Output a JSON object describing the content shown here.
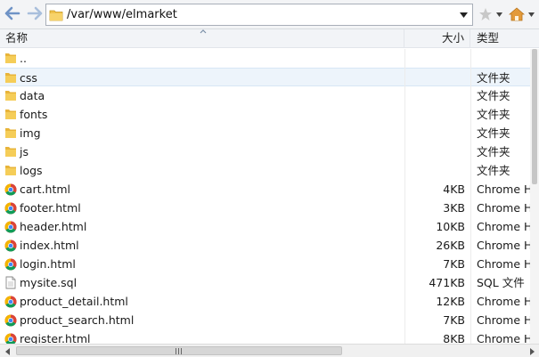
{
  "toolbar": {
    "path": "/var/www/elmarket",
    "back_icon": "back-arrow-icon",
    "forward_icon": "forward-arrow-icon"
  },
  "columns": {
    "name": "名称",
    "size": "大小",
    "type": "类型"
  },
  "files": [
    {
      "name": "..",
      "size": "",
      "type": "",
      "icon": "folder"
    },
    {
      "name": "css",
      "size": "",
      "type": "文件夹",
      "icon": "folder",
      "selected": true
    },
    {
      "name": "data",
      "size": "",
      "type": "文件夹",
      "icon": "folder"
    },
    {
      "name": "fonts",
      "size": "",
      "type": "文件夹",
      "icon": "folder"
    },
    {
      "name": "img",
      "size": "",
      "type": "文件夹",
      "icon": "folder"
    },
    {
      "name": "js",
      "size": "",
      "type": "文件夹",
      "icon": "folder"
    },
    {
      "name": "logs",
      "size": "",
      "type": "文件夹",
      "icon": "folder"
    },
    {
      "name": "cart.html",
      "size": "4KB",
      "type": "Chrome HTML",
      "icon": "chrome"
    },
    {
      "name": "footer.html",
      "size": "3KB",
      "type": "Chrome HTML",
      "icon": "chrome"
    },
    {
      "name": "header.html",
      "size": "10KB",
      "type": "Chrome HTML",
      "icon": "chrome"
    },
    {
      "name": "index.html",
      "size": "26KB",
      "type": "Chrome HTML",
      "icon": "chrome"
    },
    {
      "name": "login.html",
      "size": "7KB",
      "type": "Chrome HTML",
      "icon": "chrome"
    },
    {
      "name": "mysite.sql",
      "size": "471KB",
      "type": "SQL 文件",
      "icon": "document"
    },
    {
      "name": "product_detail.html",
      "size": "12KB",
      "type": "Chrome HTML",
      "icon": "chrome"
    },
    {
      "name": "product_search.html",
      "size": "7KB",
      "type": "Chrome HTML",
      "icon": "chrome"
    },
    {
      "name": "register.html",
      "size": "8KB",
      "type": "Chrome HTML",
      "icon": "chrome"
    }
  ],
  "colors": {
    "folder": "#f0c24b",
    "selection": "#edf4fb",
    "nav_arrow": "#6f93c6"
  }
}
